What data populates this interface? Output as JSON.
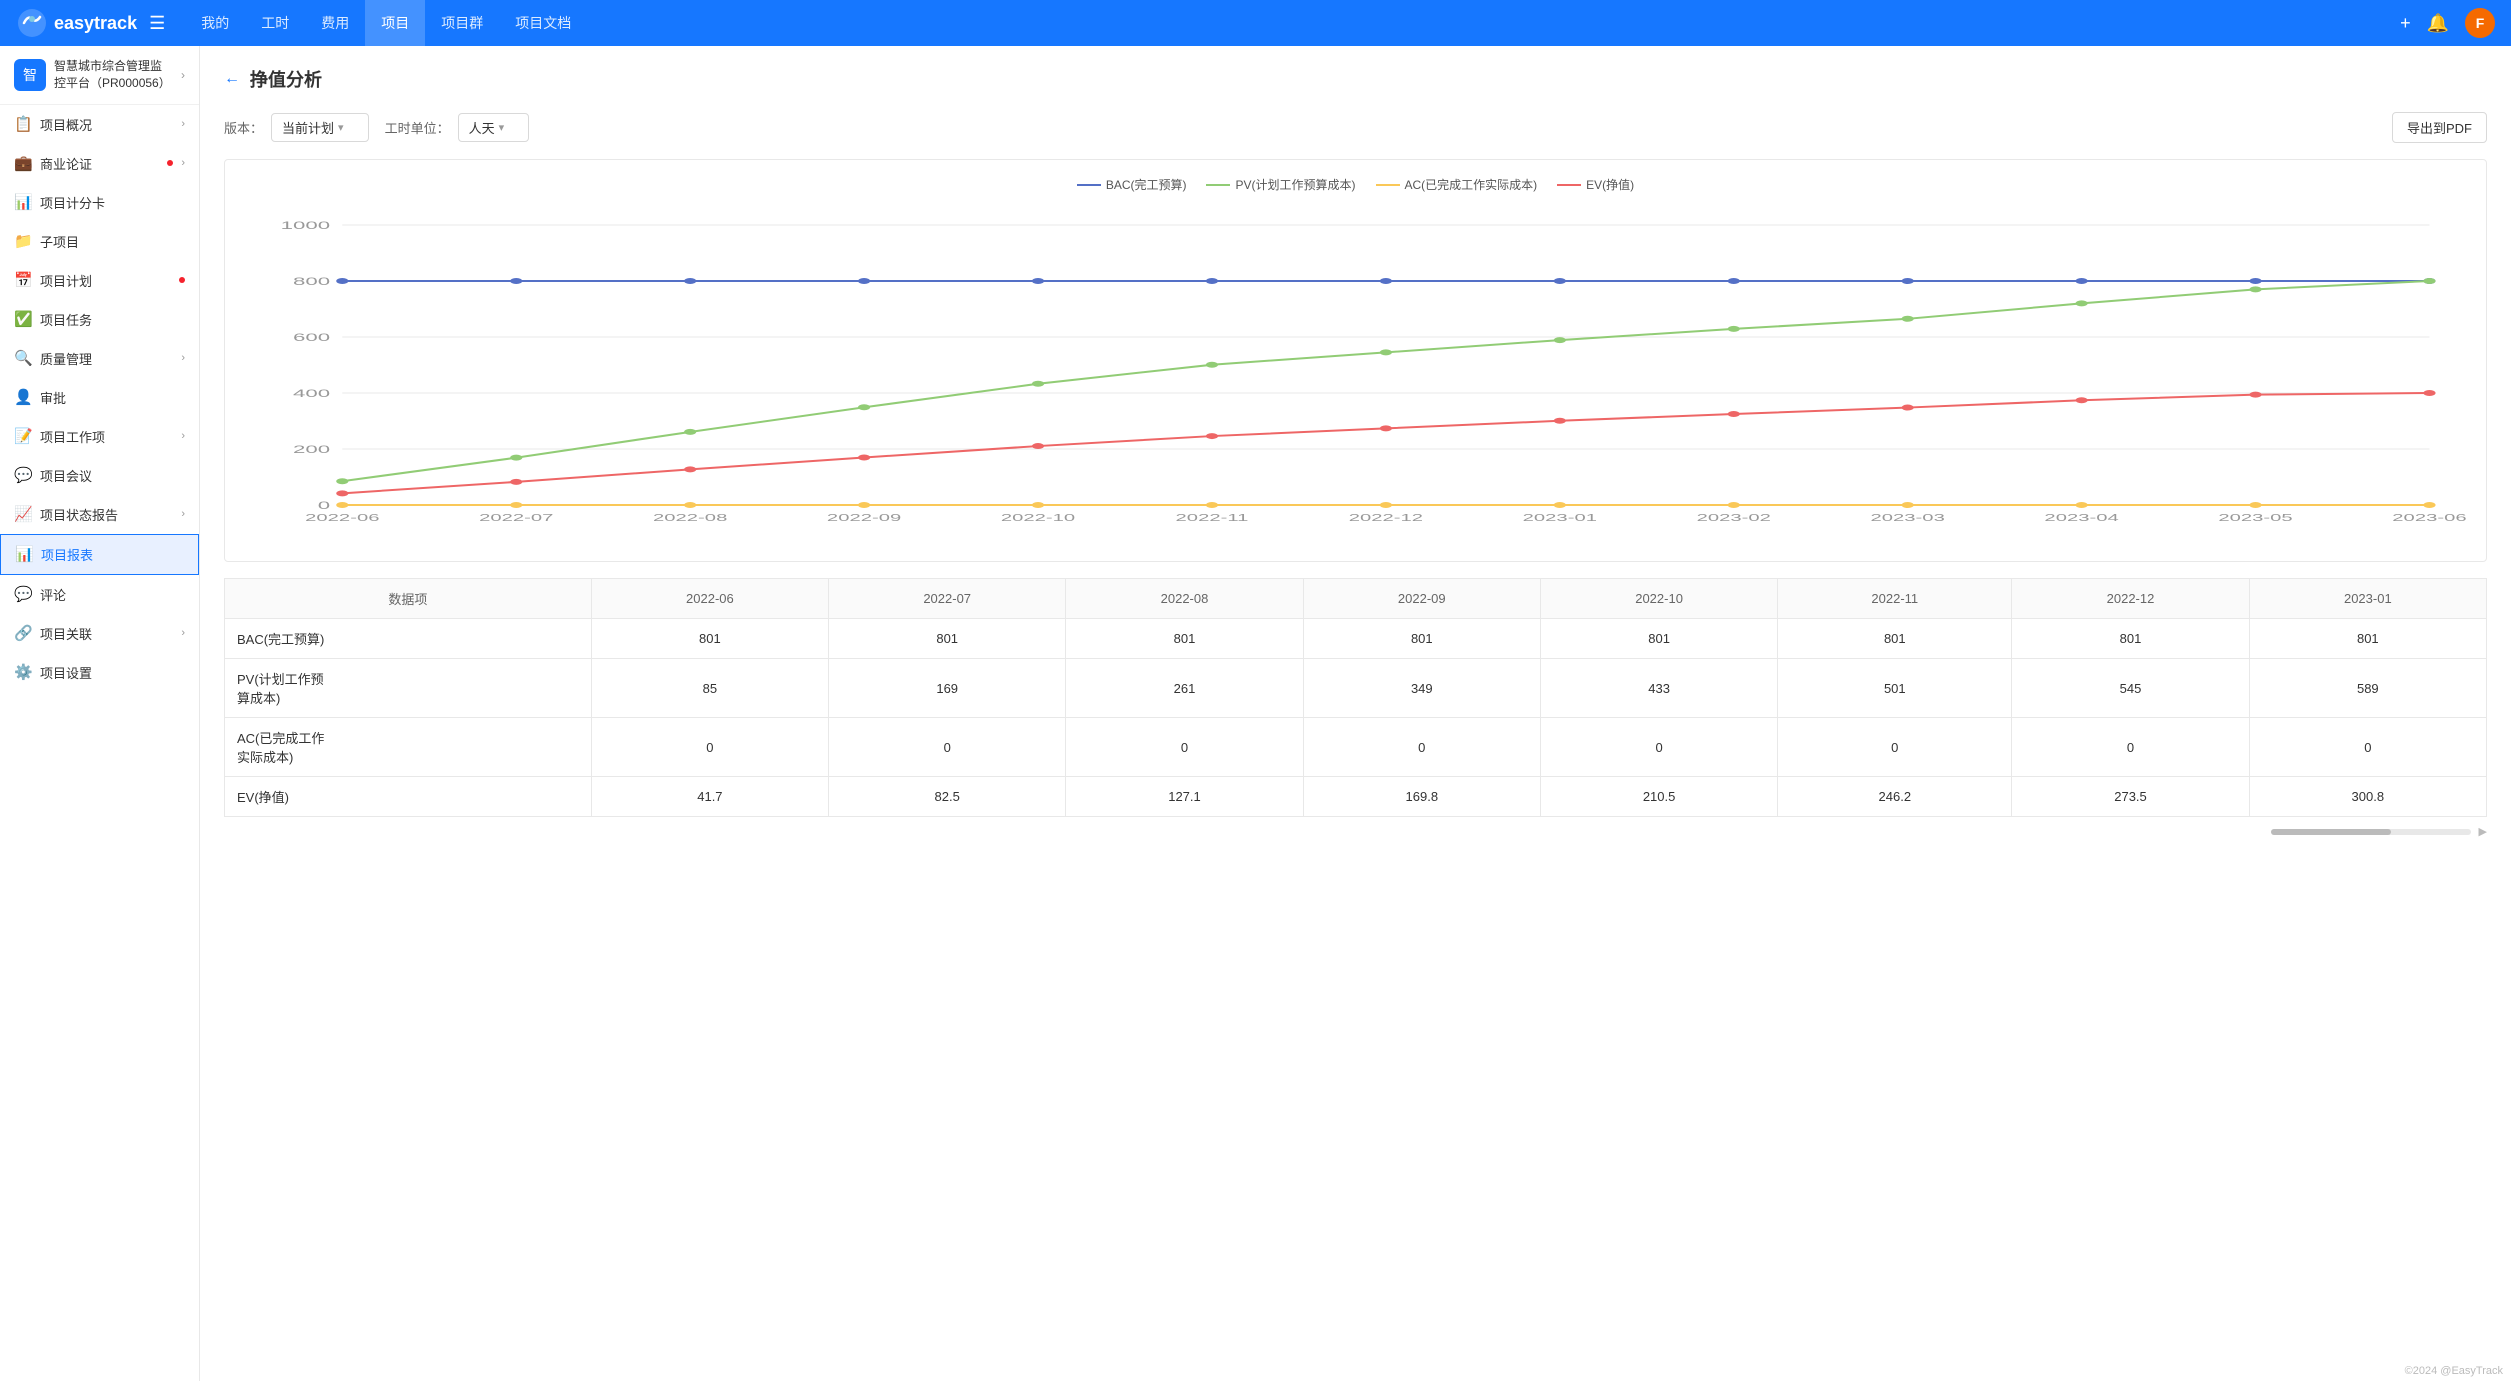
{
  "app": {
    "name": "easytrack",
    "logo_text": "easytrack"
  },
  "nav": {
    "hamburger_label": "☰",
    "items": [
      {
        "label": "我的",
        "active": false
      },
      {
        "label": "工时",
        "active": false
      },
      {
        "label": "费用",
        "active": false
      },
      {
        "label": "项目",
        "active": true
      },
      {
        "label": "项目群",
        "active": false
      },
      {
        "label": "项目文档",
        "active": false
      }
    ],
    "add_icon": "+",
    "bell_icon": "🔔",
    "avatar_text": "F"
  },
  "sidebar": {
    "project_title": "智慧城市综合管理监控平台（PR000056）",
    "items": [
      {
        "id": "project-overview",
        "icon": "📋",
        "label": "项目概况",
        "has_arrow": true,
        "has_dot": false
      },
      {
        "id": "business-case",
        "icon": "💼",
        "label": "商业论证",
        "has_arrow": true,
        "has_dot": true
      },
      {
        "id": "project-scorecard",
        "icon": "📊",
        "label": "项目计分卡",
        "has_arrow": false,
        "has_dot": false
      },
      {
        "id": "sub-project",
        "icon": "📁",
        "label": "子项目",
        "has_arrow": false,
        "has_dot": false
      },
      {
        "id": "project-plan",
        "icon": "📅",
        "label": "项目计划",
        "has_arrow": false,
        "has_dot": true
      },
      {
        "id": "project-task",
        "icon": "✅",
        "label": "项目任务",
        "has_arrow": false,
        "has_dot": false
      },
      {
        "id": "quality-management",
        "icon": "🔍",
        "label": "质量管理",
        "has_arrow": true,
        "has_dot": false
      },
      {
        "id": "approval",
        "icon": "👤",
        "label": "审批",
        "has_arrow": false,
        "has_dot": false
      },
      {
        "id": "project-work-items",
        "icon": "📝",
        "label": "项目工作项",
        "has_arrow": true,
        "has_dot": false
      },
      {
        "id": "project-meeting",
        "icon": "💬",
        "label": "项目会议",
        "has_arrow": false,
        "has_dot": false
      },
      {
        "id": "project-status-report",
        "icon": "📈",
        "label": "项目状态报告",
        "has_arrow": true,
        "has_dot": false
      },
      {
        "id": "project-report",
        "icon": "📊",
        "label": "项目报表",
        "has_arrow": false,
        "has_dot": false,
        "active": true
      },
      {
        "id": "review",
        "icon": "💬",
        "label": "评论",
        "has_arrow": false,
        "has_dot": false
      },
      {
        "id": "project-association",
        "icon": "🔗",
        "label": "项目关联",
        "has_arrow": true,
        "has_dot": false
      },
      {
        "id": "project-settings",
        "icon": "⚙️",
        "label": "项目设置",
        "has_arrow": false,
        "has_dot": false
      }
    ]
  },
  "page": {
    "back_icon": "←",
    "title": "挣值分析",
    "version_label": "版本：",
    "version_value": "当前计划",
    "unit_label": "工时单位：",
    "unit_value": "人天",
    "export_btn": "导出到PDF"
  },
  "chart": {
    "legend": [
      {
        "label": "BAC(完工预算)",
        "color": "#5470c6"
      },
      {
        "label": "PV(计划工作预算成本)",
        "color": "#91cc75"
      },
      {
        "label": "AC(已完成工作实际成本)",
        "color": "#fac858"
      },
      {
        "label": "EV(挣值)",
        "color": "#ee6666"
      }
    ],
    "y_axis": [
      0,
      200,
      400,
      600,
      800,
      1000
    ],
    "x_labels": [
      "2022-06",
      "2022-07",
      "2022-08",
      "2022-09",
      "2022-10",
      "2022-11",
      "2022-12",
      "2023-01",
      "2023-02",
      "2023-03",
      "2023-04",
      "2023-05",
      "2023-06"
    ],
    "series": {
      "BAC": [
        800,
        800,
        800,
        800,
        800,
        800,
        800,
        800,
        800,
        800,
        800,
        800,
        800
      ],
      "PV": [
        85,
        169,
        261,
        349,
        433,
        501,
        545,
        589,
        629,
        665,
        720,
        770,
        800
      ],
      "AC": [
        0,
        0,
        0,
        0,
        0,
        0,
        0,
        0,
        0,
        0,
        0,
        0,
        0
      ],
      "EV": [
        41.7,
        82.5,
        127.1,
        169.8,
        210.5,
        246.2,
        273.5,
        300.8,
        325,
        348,
        374,
        394,
        400
      ]
    }
  },
  "table": {
    "headers": [
      "数据项",
      "2022-06",
      "2022-07",
      "2022-08",
      "2022-09",
      "2022-10",
      "2022-11",
      "2022-12",
      "2023-01"
    ],
    "rows": [
      {
        "name": "BAC(完工预算)",
        "values": [
          801,
          801,
          801,
          801,
          801,
          801,
          801,
          801
        ]
      },
      {
        "name": "PV(计划工作预\n算成本)",
        "values": [
          85,
          169,
          261,
          349,
          433,
          501,
          545,
          589
        ]
      },
      {
        "name": "AC(已完成工作\n实际成本)",
        "values": [
          0,
          0,
          0,
          0,
          0,
          0,
          0,
          0
        ]
      },
      {
        "name": "EV(挣值)",
        "values": [
          41.7,
          82.5,
          127.1,
          169.8,
          210.5,
          246.2,
          273.5,
          300.8
        ]
      }
    ]
  },
  "copyright": "©2024 @EasyTrack"
}
